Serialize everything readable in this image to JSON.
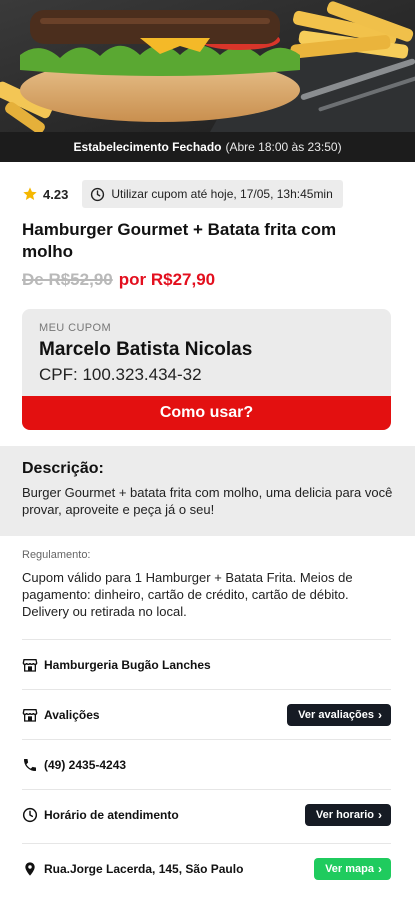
{
  "status_bar": {
    "title": "Estabelecimento Fechado",
    "hours": "(Abre 18:00 às 23:50)"
  },
  "meta": {
    "rating": "4.23",
    "coupon_validity": "Utilizar cupom até hoje, 17/05, 13h:45min"
  },
  "offer": {
    "title": "Hamburger Gourmet + Batata frita com molho",
    "old_price": "De R$52,90",
    "new_price": "por R$27,90"
  },
  "coupon": {
    "label": "MEU CUPOM",
    "name": "Marcelo Batista Nicolas",
    "cpf": "CPF: 100.323.434-32",
    "how_to_use_label": "Como usar?"
  },
  "description": {
    "title": "Descrição:",
    "text": "Burger Gourmet + batata frita com molho, uma delicia para você provar, aproveite e peça já o seu!"
  },
  "regulation": {
    "title": "Regulamento:",
    "text": "Cupom válido para 1 Hamburger + Batata Frita. Meios de pagamento: dinheiro, cartão de crédito, cartão de débito. Delivery ou retirada no local."
  },
  "info": {
    "store_name": "Hamburgeria Bugão Lanches",
    "reviews_label": "Avalições",
    "reviews_button": "Ver avaliações",
    "phone": "(49) 2435-4243",
    "hours_label": "Horário de atendimento",
    "hours_button": "Ver horario",
    "address": "Rua.Jorge Lacerda, 145, São Paulo",
    "map_button": "Ver mapa"
  },
  "colors": {
    "accent_red": "#e31010",
    "price_red": "#e30f1e",
    "dark_button": "#161b24",
    "green_button": "#1fcb5e",
    "star": "#f5b700"
  },
  "icons": [
    "star-icon",
    "clock-icon",
    "store-icon",
    "reviews-store-icon",
    "phone-icon",
    "clock-icon",
    "location-pin-icon",
    "chevron-right-icon"
  ]
}
